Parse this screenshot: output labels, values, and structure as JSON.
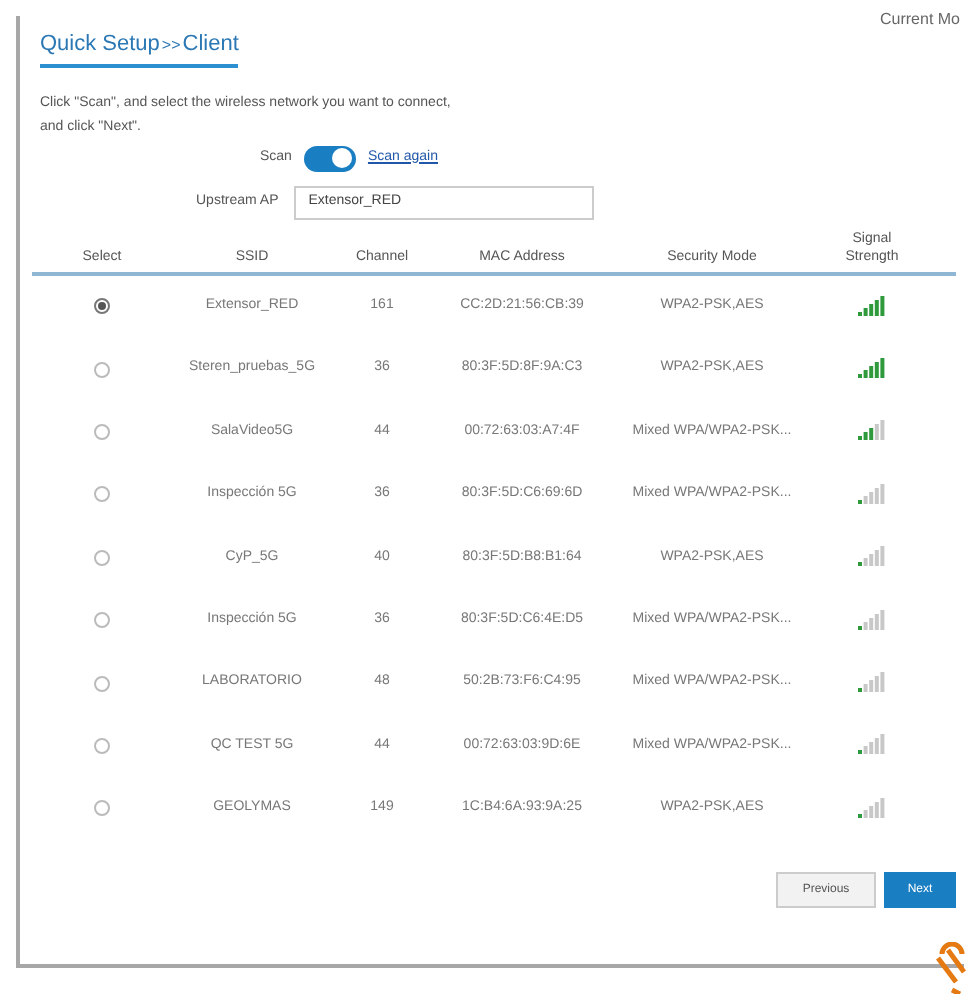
{
  "corner_text": "Current Mo",
  "breadcrumb": {
    "parent": "Quick Setup",
    "separator": ">>",
    "current": "Client"
  },
  "instructions": [
    "Click \"Scan\", and select the wireless network you want to connect,",
    "and click \"Next\"."
  ],
  "scan": {
    "label": "Scan",
    "on": true,
    "link": "Scan again"
  },
  "upstream_ap": {
    "label": "Upstream AP",
    "value": "Extensor_RED"
  },
  "table": {
    "columns": [
      "Select",
      "SSID",
      "Channel",
      "MAC Address",
      "Security Mode",
      "Signal Strength"
    ],
    "rows": [
      {
        "selected": true,
        "ssid": "Extensor_RED",
        "channel": "161",
        "mac": "CC:2D:21:56:CB:39",
        "security": "WPA2-PSK,AES",
        "kind": "full"
      },
      {
        "selected": false,
        "ssid": "Steren_pruebas_5G",
        "channel": "36",
        "mac": "80:3F:5D:8F:9A:C3",
        "security": "WPA2-PSK,AES",
        "kind": "full"
      },
      {
        "selected": false,
        "ssid": "SalaVideo5G",
        "channel": "44",
        "mac": "00:72:63:03:A7:4F",
        "security": "Mixed WPA/WPA2-PSK...",
        "kind": "medium"
      },
      {
        "selected": false,
        "ssid": "Inspección 5G",
        "channel": "36",
        "mac": "80:3F:5D:C6:69:6D",
        "security": "Mixed WPA/WPA2-PSK...",
        "kind": "low"
      },
      {
        "selected": false,
        "ssid": "CyP_5G",
        "channel": "40",
        "mac": "80:3F:5D:B8:B1:64",
        "security": "WPA2-PSK,AES",
        "kind": "low"
      },
      {
        "selected": false,
        "ssid": "Inspección 5G",
        "channel": "36",
        "mac": "80:3F:5D:C6:4E:D5",
        "security": "Mixed WPA/WPA2-PSK...",
        "kind": "low"
      },
      {
        "selected": false,
        "ssid": "LABORATORIO",
        "channel": "48",
        "mac": "50:2B:73:F6:C4:95",
        "security": "Mixed WPA/WPA2-PSK...",
        "kind": "low"
      },
      {
        "selected": false,
        "ssid": "QC TEST 5G",
        "channel": "44",
        "mac": "00:72:63:03:9D:6E",
        "security": "Mixed WPA/WPA2-PSK...",
        "kind": "low"
      },
      {
        "selected": false,
        "ssid": "GEOLYMAS",
        "channel": "149",
        "mac": "1C:B4:6A:93:9A:25",
        "security": "WPA2-PSK,AES",
        "kind": "low"
      }
    ]
  },
  "buttons": [
    {
      "label": "Previous",
      "kind": "secondary"
    },
    {
      "label": "Next",
      "kind": "primary"
    }
  ]
}
